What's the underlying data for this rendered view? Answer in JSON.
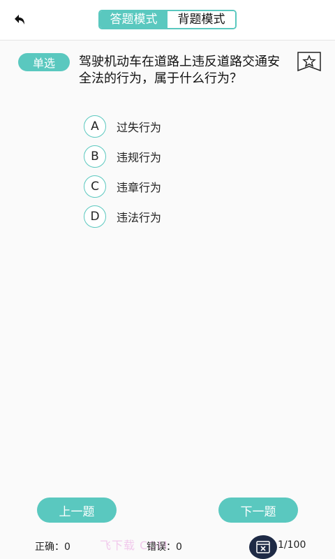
{
  "header": {
    "mode_answer": "答题模式",
    "mode_memorize": "背题模式",
    "accent": "#5ac8bf"
  },
  "question": {
    "type_label": "单选",
    "text": "驾驶机动车在道路上违反道路交通安全法的行为，属于什么行为？",
    "options": [
      {
        "letter": "A",
        "text": "过失行为"
      },
      {
        "letter": "B",
        "text": "违规行为"
      },
      {
        "letter": "C",
        "text": "违章行为"
      },
      {
        "letter": "D",
        "text": "违法行为"
      }
    ]
  },
  "navigation": {
    "prev_label": "上一题",
    "next_label": "下一题"
  },
  "footer": {
    "correct": "正确：0",
    "wrong": "错误：0",
    "progress": "1/100",
    "watermark": "飞下载 COM"
  },
  "icons": {
    "back": "back-arrow-icon",
    "favorite": "star-icon",
    "answer_card": "answer-card-icon"
  }
}
